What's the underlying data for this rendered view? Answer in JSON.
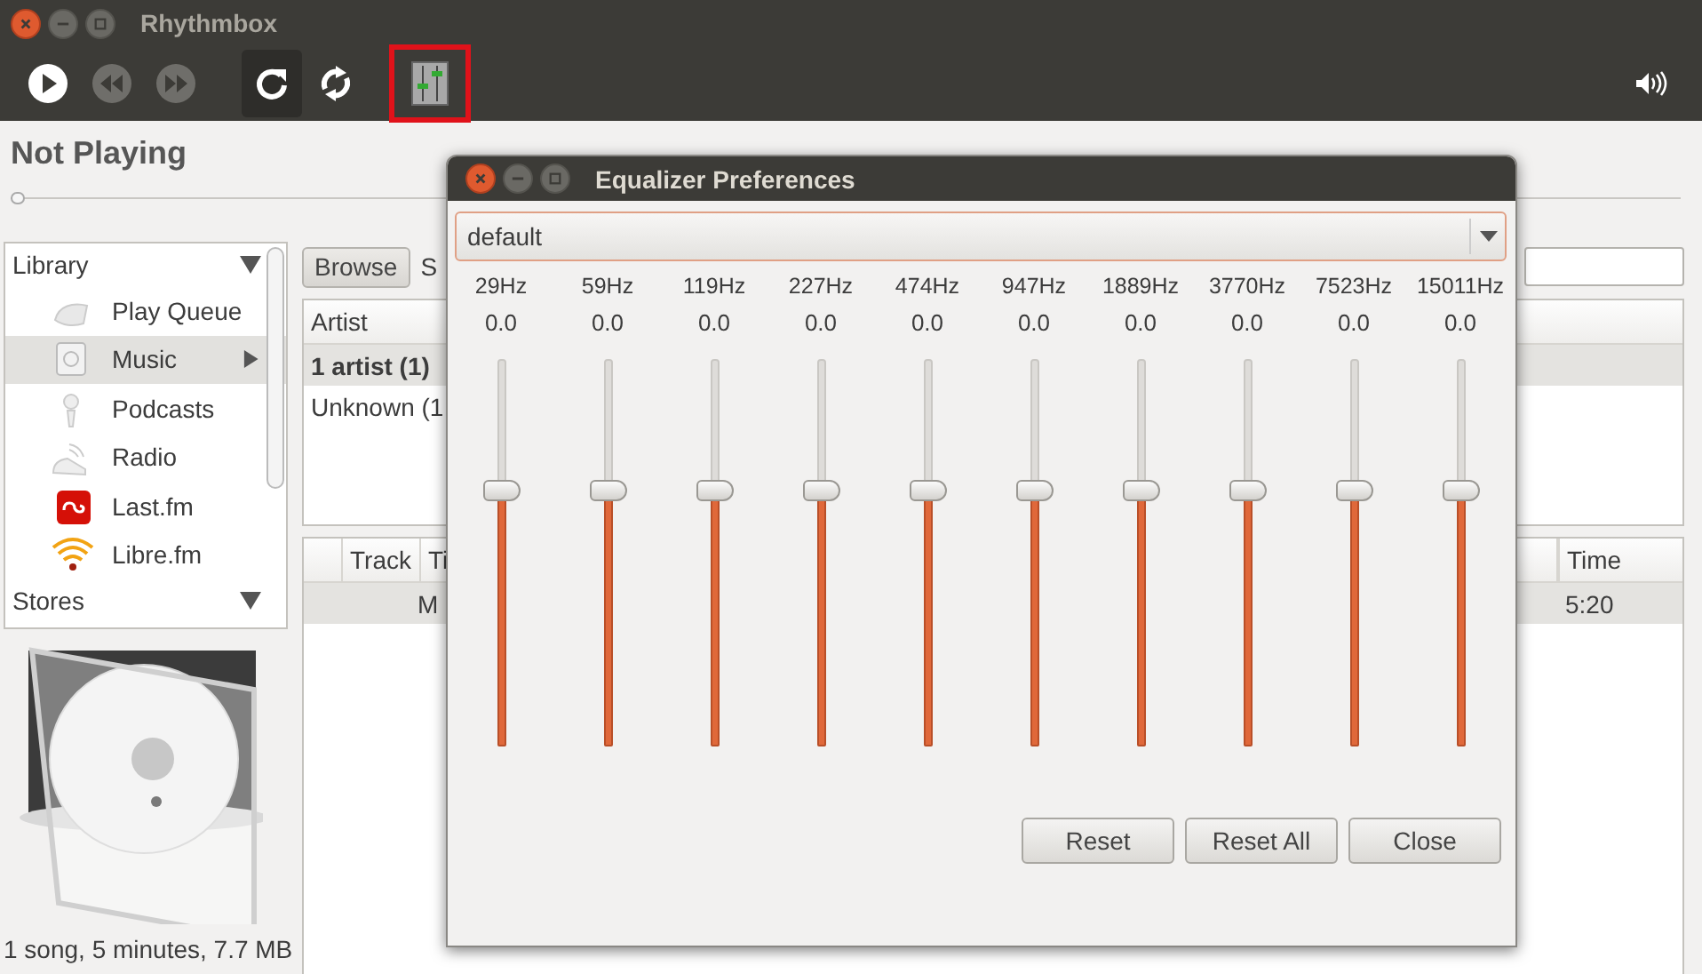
{
  "window": {
    "title": "Rhythmbox"
  },
  "toolbar": {
    "buttons": [
      {
        "kind": "play",
        "disabled": false,
        "pressed": false,
        "highlighted": false
      },
      {
        "kind": "previous",
        "disabled": true,
        "pressed": false,
        "highlighted": false
      },
      {
        "kind": "next",
        "disabled": true,
        "pressed": false,
        "highlighted": false
      },
      {
        "kind": "repeat",
        "disabled": false,
        "pressed": true,
        "highlighted": false
      },
      {
        "kind": "shuffle",
        "disabled": false,
        "pressed": false,
        "highlighted": false
      },
      {
        "kind": "equalizer",
        "disabled": false,
        "pressed": false,
        "highlighted": true
      }
    ]
  },
  "now_playing": {
    "title": "Not Playing",
    "level": 0
  },
  "sidebar": {
    "items": [
      {
        "kind": "header",
        "label": "Library",
        "expanded": true,
        "selected": false
      },
      {
        "kind": "queue",
        "label": "Play Queue",
        "selected": false
      },
      {
        "kind": "music",
        "label": "Music",
        "selected": true
      },
      {
        "kind": "podcast",
        "label": "Podcasts",
        "selected": false
      },
      {
        "kind": "radio",
        "label": "Radio",
        "selected": false
      },
      {
        "kind": "lastfm",
        "label": "Last.fm",
        "selected": false
      },
      {
        "kind": "librefm",
        "label": "Libre.fm",
        "selected": false
      },
      {
        "kind": "header",
        "label": "Stores",
        "expanded": true,
        "selected": false
      }
    ]
  },
  "browser": {
    "browse_button": "Browse",
    "show_label": "S"
  },
  "artist_pane": {
    "header": "Artist",
    "rows": [
      {
        "text": "1 artist (1)",
        "selected": true
      },
      {
        "text": "Unknown (1",
        "selected": false
      }
    ]
  },
  "tracks": {
    "columns": [
      "Track",
      "Ti",
      "Time"
    ],
    "rows": [
      {
        "title": "M",
        "time": "5:20",
        "selected": true
      }
    ]
  },
  "status_bar": "1 song, 5 minutes, 7.7 MB",
  "equalizer": {
    "title": "Equalizer Preferences",
    "preset": "default",
    "bands": [
      {
        "freq": "29Hz",
        "value": "0.0",
        "level": 0.66
      },
      {
        "freq": "59Hz",
        "value": "0.0",
        "level": 0.66
      },
      {
        "freq": "119Hz",
        "value": "0.0",
        "level": 0.66
      },
      {
        "freq": "227Hz",
        "value": "0.0",
        "level": 0.66
      },
      {
        "freq": "474Hz",
        "value": "0.0",
        "level": 0.66
      },
      {
        "freq": "947Hz",
        "value": "0.0",
        "level": 0.66
      },
      {
        "freq": "1889Hz",
        "value": "0.0",
        "level": 0.66
      },
      {
        "freq": "3770Hz",
        "value": "0.0",
        "level": 0.66
      },
      {
        "freq": "7523Hz",
        "value": "0.0",
        "level": 0.66
      },
      {
        "freq": "15011Hz",
        "value": "0.0",
        "level": 0.66
      }
    ],
    "buttons": [
      "Reset",
      "Reset All",
      "Close"
    ]
  }
}
